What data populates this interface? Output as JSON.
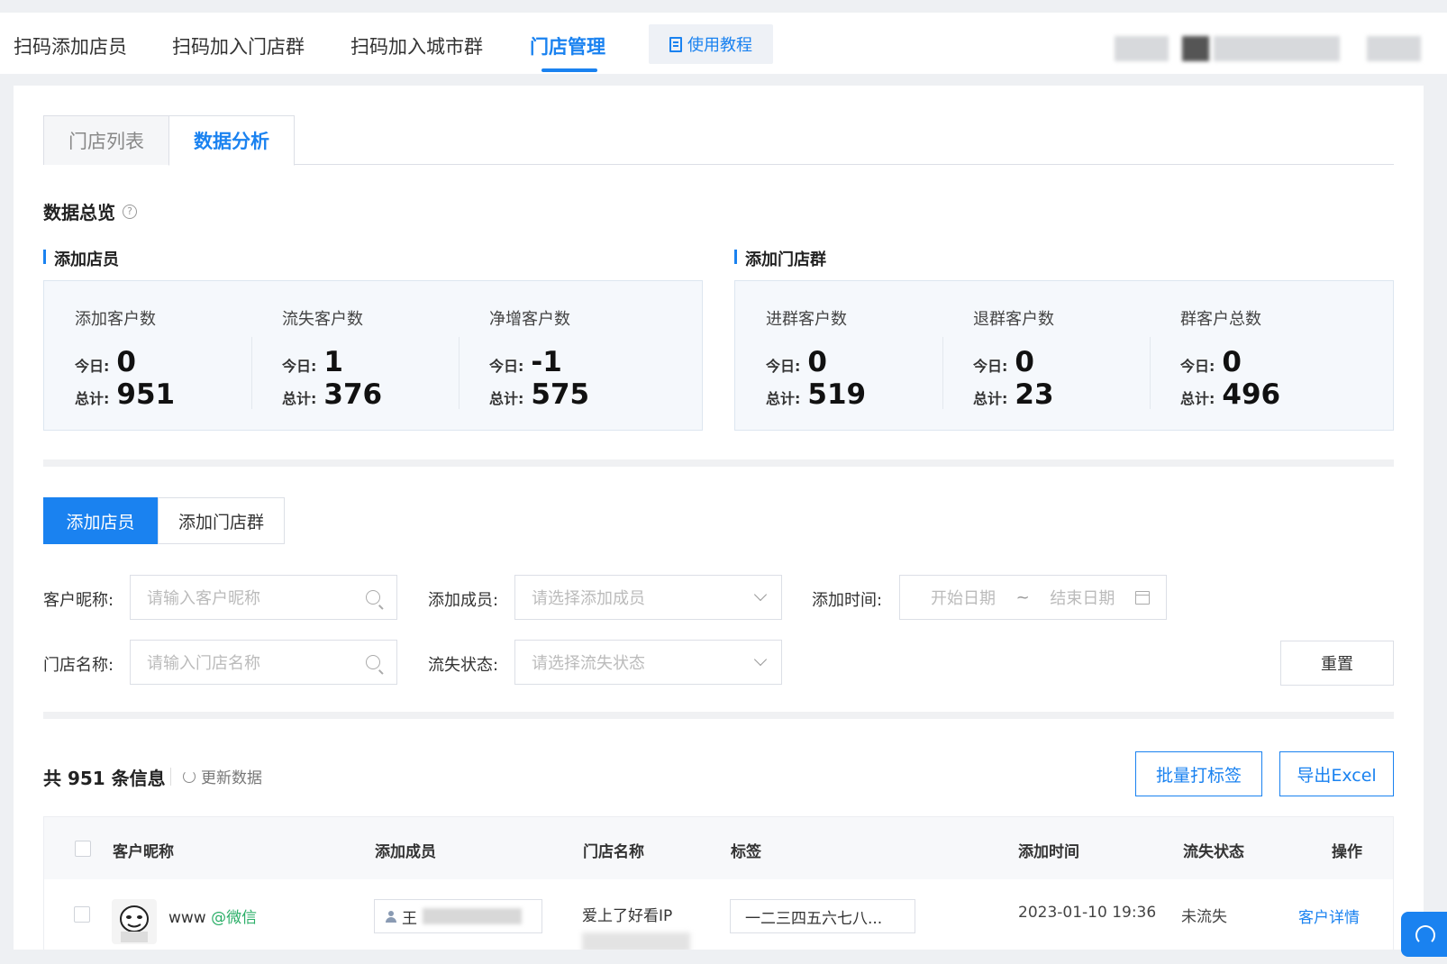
{
  "nav": {
    "items": [
      {
        "label": "扫码添加店员",
        "active": false
      },
      {
        "label": "扫码加入门店群",
        "active": false
      },
      {
        "label": "扫码加入城市群",
        "active": false
      },
      {
        "label": "门店管理",
        "active": true
      }
    ],
    "tutorial_label": "使用教程"
  },
  "tabs": {
    "list": "门店列表",
    "analysis": "数据分析"
  },
  "overview": {
    "title": "数据总览",
    "add_staff": {
      "title": "添加店员",
      "stats": [
        {
          "label": "添加客户数",
          "today_key": "今日:",
          "today": "0",
          "total_key": "总计:",
          "total": "951"
        },
        {
          "label": "流失客户数",
          "today_key": "今日:",
          "today": "1",
          "total_key": "总计:",
          "total": "376"
        },
        {
          "label": "净增客户数",
          "today_key": "今日:",
          "today": "-1",
          "total_key": "总计:",
          "total": "575"
        }
      ]
    },
    "add_group": {
      "title": "添加门店群",
      "stats": [
        {
          "label": "进群客户数",
          "today_key": "今日:",
          "today": "0",
          "total_key": "总计:",
          "total": "519"
        },
        {
          "label": "退群客户数",
          "today_key": "今日:",
          "today": "0",
          "total_key": "总计:",
          "total": "23"
        },
        {
          "label": "群客户总数",
          "today_key": "今日:",
          "today": "0",
          "total_key": "总计:",
          "total": "496"
        }
      ]
    }
  },
  "segment": {
    "active": "添加店员",
    "inactive": "添加门店群"
  },
  "filters": {
    "nickname_label": "客户昵称:",
    "nickname_placeholder": "请输入客户昵称",
    "member_label": "添加成员:",
    "member_placeholder": "请选择添加成员",
    "time_label": "添加时间:",
    "start_placeholder": "开始日期",
    "date_sep": "~",
    "end_placeholder": "结束日期",
    "store_label": "门店名称:",
    "store_placeholder": "请输入门店名称",
    "lost_label": "流失状态:",
    "lost_placeholder": "请选择流失状态",
    "reset": "重置"
  },
  "list": {
    "total": "共 951 条信息",
    "refresh": "更新数据",
    "batch_tag": "批量打标签",
    "export": "导出Excel",
    "columns": [
      "客户昵称",
      "添加成员",
      "门店名称",
      "标签",
      "添加时间",
      "流失状态",
      "操作"
    ],
    "rows": [
      {
        "nickname": "www",
        "source": "@微信",
        "member": "王",
        "store": "爱上了好看IP",
        "tag": "一二三四五六七八...",
        "time": "2023-01-10 19:36",
        "lost": "未流失",
        "action": "客户详情"
      }
    ]
  },
  "colors": {
    "accent": "#1a82f0",
    "wechat": "#2aae67"
  }
}
